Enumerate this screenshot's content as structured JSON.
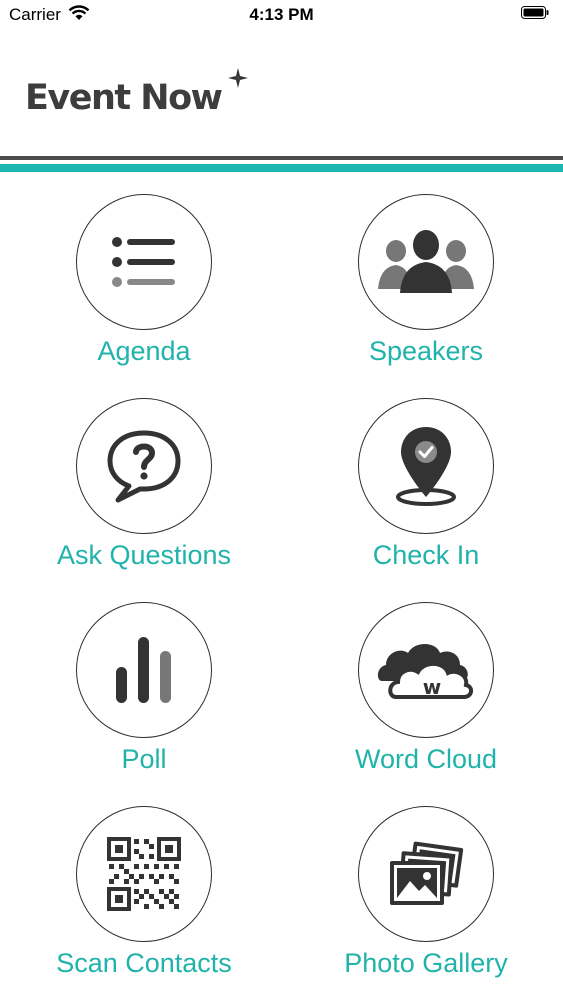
{
  "status_bar": {
    "carrier": "Carrier",
    "time": "4:13 PM"
  },
  "app": {
    "logo_text": "Event Now"
  },
  "colors": {
    "accent": "#1db6ae",
    "rule": "#4b4b4b",
    "icon": "#333333"
  },
  "menu": [
    {
      "label": "Agenda",
      "icon": "list-icon"
    },
    {
      "label": "Speakers",
      "icon": "people-icon"
    },
    {
      "label": "Ask Questions",
      "icon": "question-bubble-icon"
    },
    {
      "label": "Check In",
      "icon": "location-pin-icon"
    },
    {
      "label": "Poll",
      "icon": "bar-chart-icon"
    },
    {
      "label": "Word Cloud",
      "icon": "cloud-icon"
    },
    {
      "label": "Scan Contacts",
      "icon": "qr-code-icon"
    },
    {
      "label": "Photo Gallery",
      "icon": "photos-icon"
    }
  ],
  "icons_text": {
    "word_cloud_letter": "w"
  }
}
